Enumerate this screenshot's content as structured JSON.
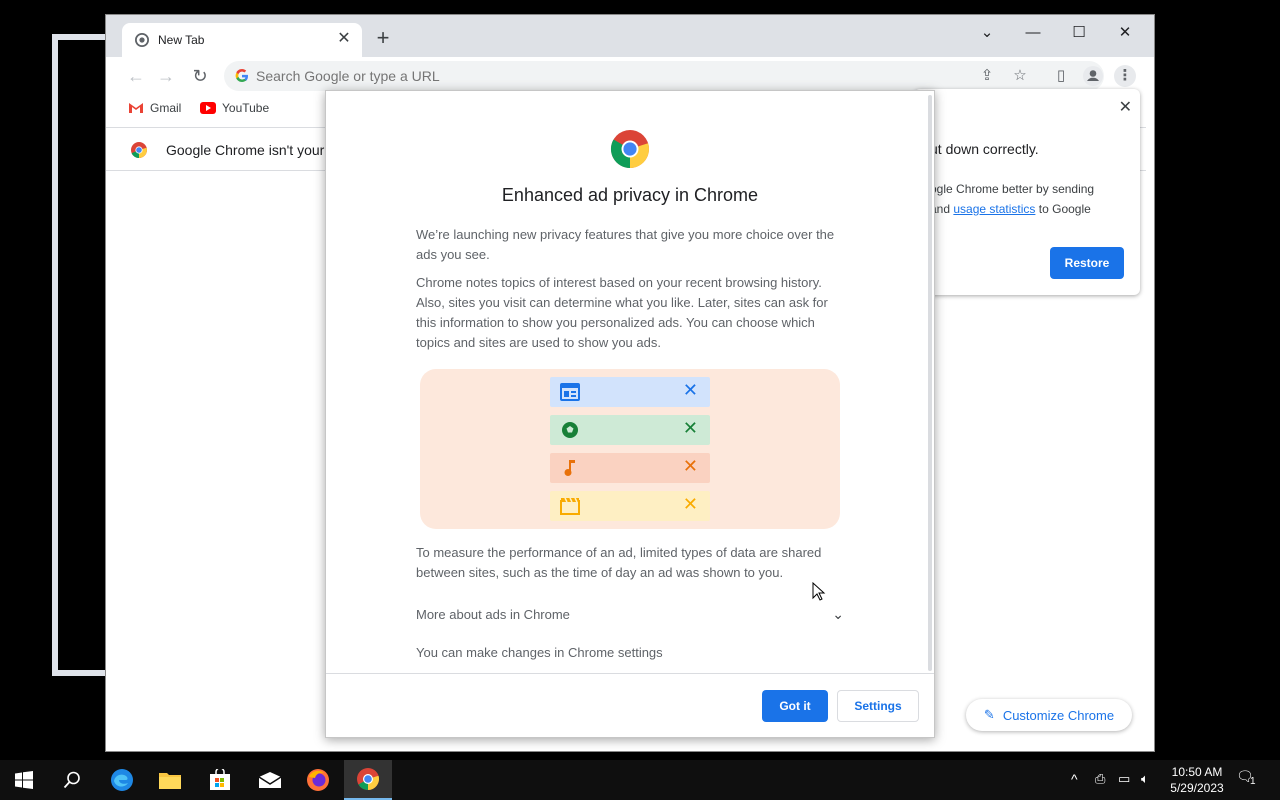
{
  "tab": {
    "title": "New Tab"
  },
  "omnibox": {
    "placeholder": "Search Google or type a URL"
  },
  "bookmarks": [
    {
      "label": "Gmail"
    },
    {
      "label": "YouTube"
    }
  ],
  "infobar": {
    "text": "Google Chrome isn't your de"
  },
  "restore_bubble": {
    "title": "ut down correctly.",
    "body_line1": "ogle Chrome better by sending",
    "body_and": "and",
    "body_link": "usage statistics",
    "body_tail": "to Google",
    "button": "Restore"
  },
  "dialog": {
    "title": "Enhanced ad privacy in Chrome",
    "para1": "We’re launching new privacy features that give you more choice over the ads you see.",
    "para2": "Chrome notes topics of interest based on your recent browsing history. Also, sites you visit can determine what you like. Later, sites can ask for this information to show you personalized ads. You can choose which topics and sites are used to show you ads.",
    "para3": "To measure the performance of an ad, limited types of data are shared between sites, such as the time of day an ad was shown to you.",
    "more_ads": "More about ads in Chrome",
    "settings_note": "You can make changes in Chrome settings",
    "got_it": "Got it",
    "settings": "Settings",
    "topics": [
      {
        "icon": "news-icon",
        "bg": "#d2e3fc",
        "color": "#1a73e8"
      },
      {
        "icon": "sports-icon",
        "bg": "#ceead6",
        "color": "#188038"
      },
      {
        "icon": "music-icon",
        "bg": "#fad2c1",
        "color": "#e8710a"
      },
      {
        "icon": "movie-icon",
        "bg": "#feefc3",
        "color": "#f9ab00"
      }
    ]
  },
  "customize": {
    "label": "Customize Chrome"
  },
  "clock": {
    "time": "10:50 AM",
    "date": "5/29/2023"
  },
  "tray": {
    "notifications": "1"
  }
}
